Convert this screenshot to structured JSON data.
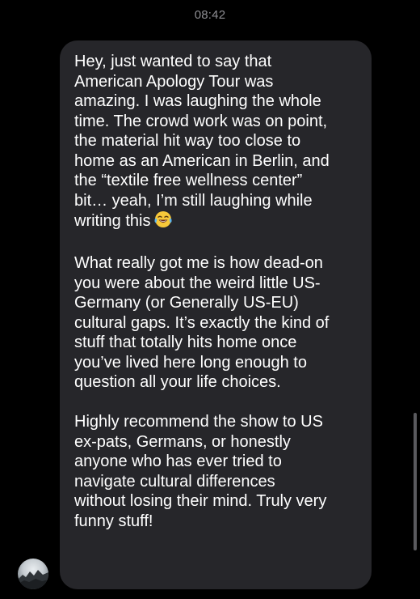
{
  "time": "08:42",
  "message": {
    "paragraph1": [
      "Hey, just wanted to say that",
      "American Apology Tour was",
      "amazing. I was laughing the whole",
      "time. The crowd work was on point,",
      "the material hit way too close to",
      "home as an American in Berlin, and",
      "the “textile free wellness center”",
      "bit… yeah, I’m still laughing while",
      "writing this"
    ],
    "paragraph2": [
      "What really got me is how dead-on",
      "you were about the weird little US-",
      "Germany (or Generally US-EU)",
      "cultural gaps. It’s exactly the kind of",
      "stuff that totally hits home once",
      "you’ve lived here long enough to",
      "question all your life choices."
    ],
    "paragraph3": [
      "Highly recommend the show to US",
      "ex-pats, Germans, or honestly",
      "anyone who has ever tried to",
      "navigate cultural differences",
      "without losing their mind. Truly very",
      "funny stuff!"
    ],
    "emoji_icon": "laughing-tears-emoji"
  },
  "colors": {
    "background": "#000000",
    "bubble": "#26262a",
    "text": "#ffffff",
    "timestamp": "#8e8e93"
  }
}
